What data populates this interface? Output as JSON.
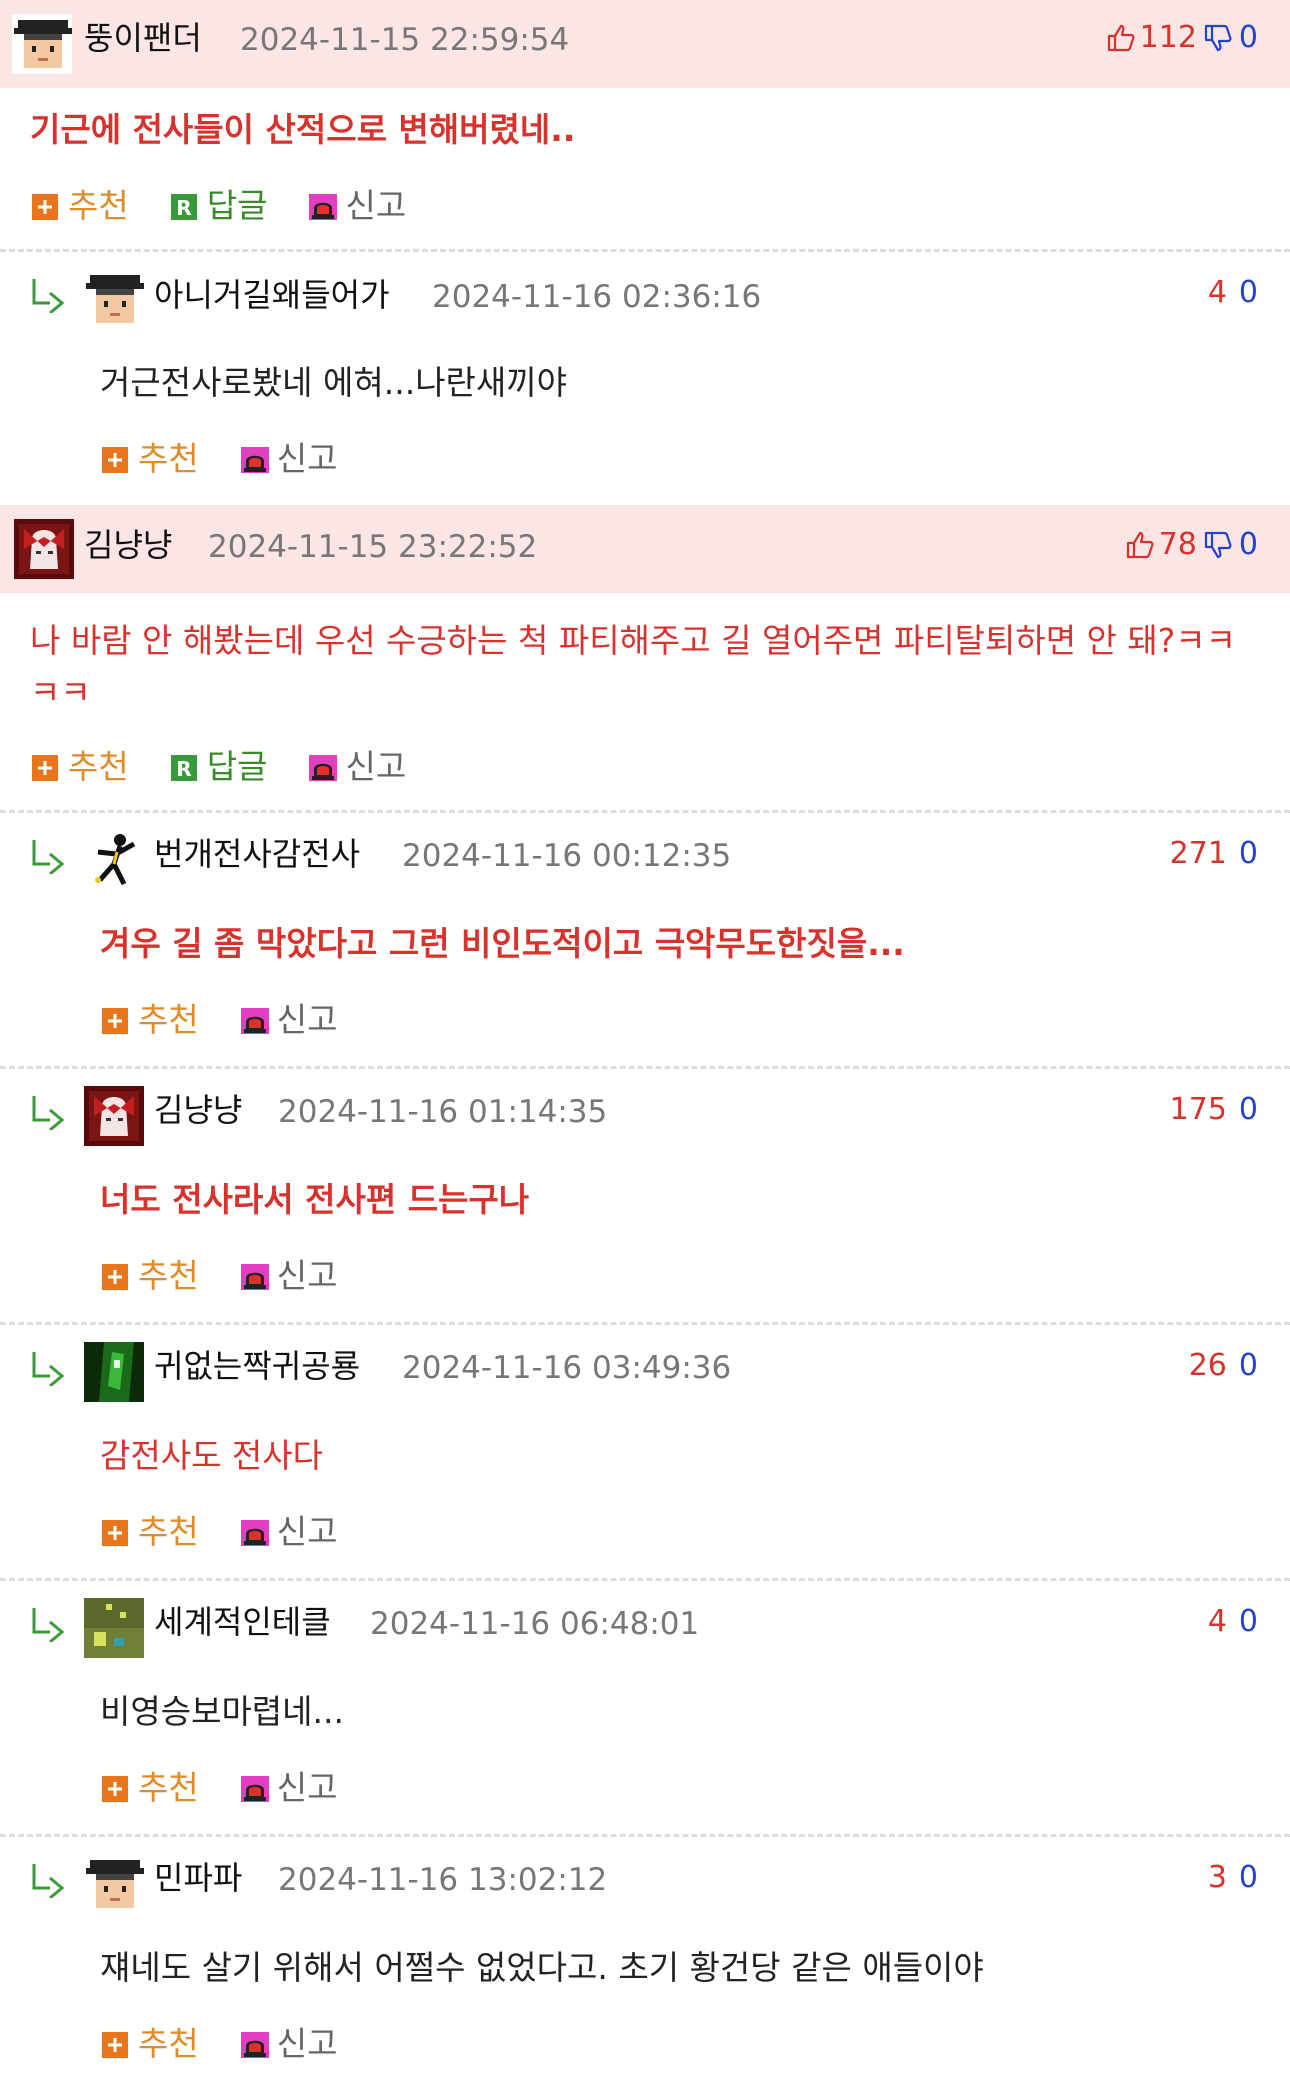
{
  "actions": {
    "recommend": "추천",
    "reply": "답글",
    "report": "신고"
  },
  "colors": {
    "top_bg": "#fbe5e5",
    "accent_red": "#d9312b",
    "down_blue": "#2244cc",
    "recommend_orange": "#e08a2a",
    "reply_green": "#3a8a2a"
  },
  "comments": [
    {
      "nick": "뚱이팬더",
      "date": "2024-11-15 22:59:54",
      "up": "112",
      "down": "0",
      "text": "기근에 전사들이 산적으로 변해버렸네..",
      "avatar": "pixel-guy-avatar"
    },
    {
      "nick": "아니거길왜들어가",
      "date": "2024-11-16 02:36:16",
      "up": "4",
      "down": "0",
      "text": "거근전사로봤네 에혀...나란새끼야",
      "avatar": "pixel-guy-avatar"
    },
    {
      "nick": "김냥냥",
      "date": "2024-11-15 23:22:52",
      "up": "78",
      "down": "0",
      "text": "나 바람 안 해봤는데 우선 수긍하는 척 파티해주고 길 열어주면 파티탈퇴하면 안 돼?ㅋㅋ ㅋㅋ",
      "avatar": "red-hair-avatar"
    },
    {
      "nick": "번개전사감전사",
      "date": "2024-11-16 00:12:35",
      "up": "271",
      "down": "0",
      "text": "겨우 길 좀 막았다고 그런 비인도적이고 극악무도한짓을...",
      "avatar": "dancer-avatar"
    },
    {
      "nick": "김냥냥",
      "date": "2024-11-16 01:14:35",
      "up": "175",
      "down": "0",
      "text": "너도 전사라서 전사편 드는구나",
      "avatar": "red-hair-avatar"
    },
    {
      "nick": "귀없는짝귀공룡",
      "date": "2024-11-16 03:49:36",
      "up": "26",
      "down": "0",
      "text": "감전사도 전사다",
      "avatar": "green-avatar"
    },
    {
      "nick": "세계적인테클",
      "date": "2024-11-16 06:48:01",
      "up": "4",
      "down": "0",
      "text": "비영승보마렵네...",
      "avatar": "olive-avatar"
    },
    {
      "nick": "민파파",
      "date": "2024-11-16 13:02:12",
      "up": "3",
      "down": "0",
      "text": "쟤네도 살기 위해서 어쩔수 없었다고. 초기 황건당 같은 애들이야",
      "avatar": "pixel-guy-avatar"
    }
  ]
}
